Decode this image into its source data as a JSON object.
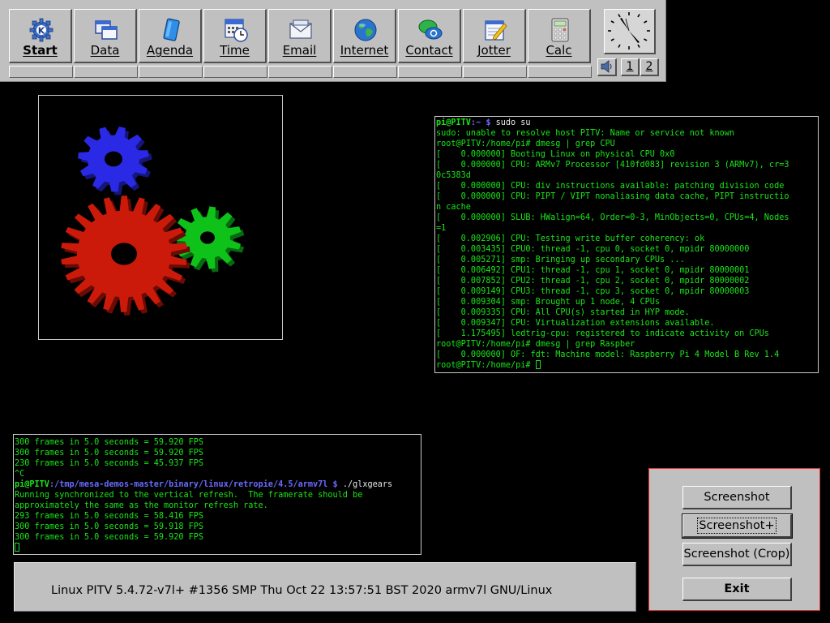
{
  "launcher": {
    "buttons": [
      {
        "label": "Start",
        "icon": "kde-gear-icon"
      },
      {
        "label": "Data",
        "icon": "windows-icon"
      },
      {
        "label": "Agenda",
        "icon": "notebook-icon"
      },
      {
        "label": "Time",
        "icon": "calendar-clock-icon"
      },
      {
        "label": "Email",
        "icon": "envelope-icon"
      },
      {
        "label": "Internet",
        "icon": "globe-icon"
      },
      {
        "label": "Contact",
        "icon": "chat-bubbles-icon"
      },
      {
        "label": "Jotter",
        "icon": "notepad-pen-icon"
      },
      {
        "label": "Calc",
        "icon": "calculator-icon"
      }
    ],
    "desktop_buttons": [
      "1",
      "2"
    ]
  },
  "terminal_top": {
    "lines": [
      {
        "segments": [
          {
            "t": "pi@PITV",
            "c": "user"
          },
          {
            "t": ":~ $ ",
            "c": "path"
          },
          {
            "t": "sudo su",
            "c": "cmd"
          }
        ]
      },
      {
        "text": "sudo: unable to resolve host PITV: Name or service not known"
      },
      {
        "text": "root@PITV:/home/pi# dmesg | grep CPU"
      },
      {
        "text": "[    0.000000] Booting Linux on physical CPU 0x0"
      },
      {
        "text": "[    0.000000] CPU: ARMv7 Processor [410fd083] revision 3 (ARMv7), cr=3"
      },
      {
        "text": "0c5383d"
      },
      {
        "text": "[    0.000000] CPU: div instructions available: patching division code"
      },
      {
        "text": "[    0.000000] CPU: PIPT / VIPT nonaliasing data cache, PIPT instructio"
      },
      {
        "text": "n cache"
      },
      {
        "text": "[    0.000000] SLUB: HWalign=64, Order=0-3, MinObjects=0, CPUs=4, Nodes"
      },
      {
        "text": "=1"
      },
      {
        "text": "[    0.002906] CPU: Testing write buffer coherency: ok"
      },
      {
        "text": "[    0.003435] CPU0: thread -1, cpu 0, socket 0, mpidr 80000000"
      },
      {
        "text": "[    0.005271] smp: Bringing up secondary CPUs ..."
      },
      {
        "text": "[    0.006492] CPU1: thread -1, cpu 1, socket 0, mpidr 80000001"
      },
      {
        "text": "[    0.007852] CPU2: thread -1, cpu 2, socket 0, mpidr 80000002"
      },
      {
        "text": "[    0.009149] CPU3: thread -1, cpu 3, socket 0, mpidr 80000003"
      },
      {
        "text": "[    0.009304] smp: Brought up 1 node, 4 CPUs"
      },
      {
        "text": "[    0.009335] CPU: All CPU(s) started in HYP mode."
      },
      {
        "text": "[    0.009347] CPU: Virtualization extensions available."
      },
      {
        "text": "[    1.175495] ledtrig-cpu: registered to indicate activity on CPUs"
      },
      {
        "text": "root@PITV:/home/pi# dmesg | grep Raspber"
      },
      {
        "text": "[    0.000000] OF: fdt: Machine model: Raspberry Pi 4 Model B Rev 1.4"
      },
      {
        "text": "root@PITV:/home/pi# ",
        "cursor": true
      }
    ]
  },
  "terminal_bottom": {
    "lines": [
      {
        "text": "300 frames in 5.0 seconds = 59.920 FPS"
      },
      {
        "text": "300 frames in 5.0 seconds = 59.920 FPS"
      },
      {
        "text": "230 frames in 5.0 seconds = 45.937 FPS"
      },
      {
        "text": "^C"
      },
      {
        "segments": [
          {
            "t": "pi@PITV",
            "c": "user"
          },
          {
            "t": ":/tmp/mesa-demos-master/binary/linux/retropie/4.5/armv7l $ ",
            "c": "path"
          },
          {
            "t": "./glxgears",
            "c": "cmd"
          }
        ]
      },
      {
        "text": "Running synchronized to the vertical refresh.  The framerate should be"
      },
      {
        "text": "approximately the same as the monitor refresh rate."
      },
      {
        "text": "293 frames in 5.0 seconds = 58.416 FPS"
      },
      {
        "text": "300 frames in 5.0 seconds = 59.918 FPS"
      },
      {
        "text": "300 frames in 5.0 seconds = 59.920 FPS"
      },
      {
        "text": "",
        "cursor": true
      }
    ]
  },
  "infobar": {
    "text": "Linux PITV 5.4.72-v7l+ #1356 SMP Thu Oct 22 13:57:51 BST 2020 armv7l GNU/Linux"
  },
  "screenshot_dialog": {
    "buttons": [
      "Screenshot",
      "Screenshot+",
      "Screenshot (Crop)",
      "Exit"
    ]
  },
  "colors": {
    "terminal_text": "#19e619",
    "prompt_path": "#6a6aff",
    "panel": "#c0c0c0",
    "dialog_border": "#e43030",
    "gear_red": "#cc1a0a",
    "gear_green": "#0fc21a",
    "gear_blue": "#2a2ae6"
  }
}
